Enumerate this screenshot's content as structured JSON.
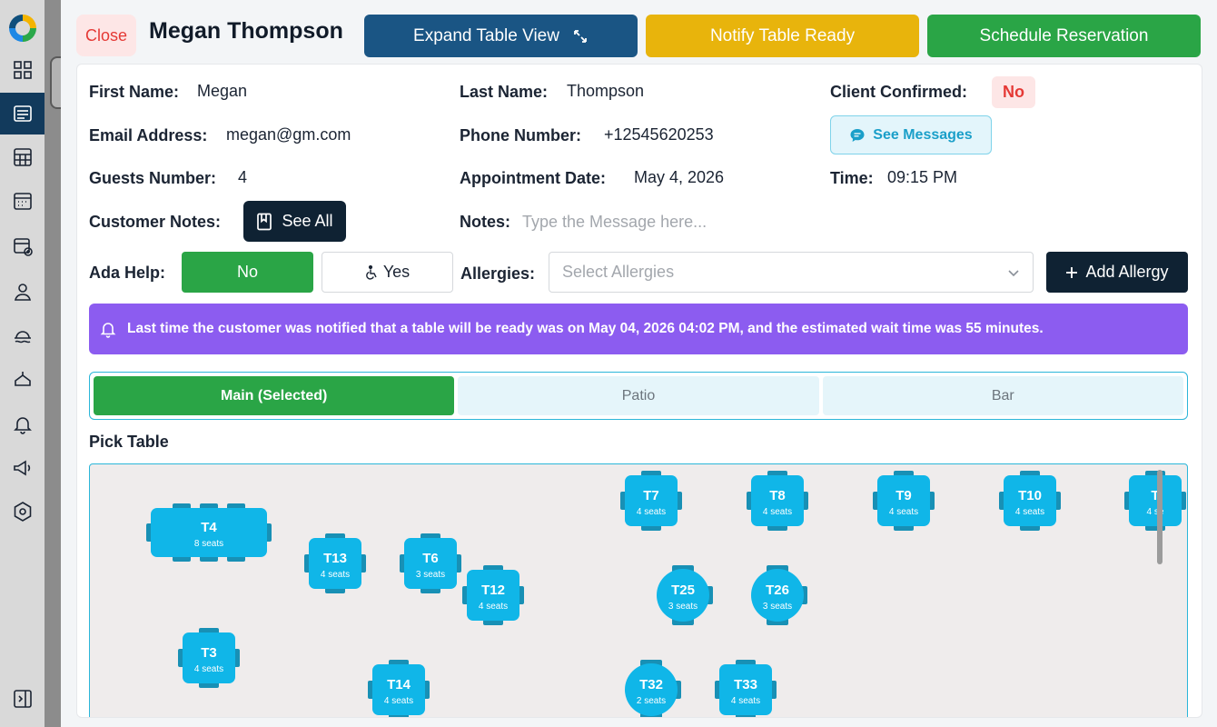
{
  "modal": {
    "close_label": "Close",
    "title": "Megan Thompson",
    "expand_label": "Expand Table View",
    "notify_label": "Notify Table Ready",
    "schedule_label": "Schedule Reservation"
  },
  "customer": {
    "first_name_label": "First Name:",
    "first_name": "Megan",
    "last_name_label": "Last Name:",
    "last_name": "Thompson",
    "confirmed_label": "Client Confirmed:",
    "confirmed": "No",
    "email_label": "Email Address:",
    "email": "megan@gm.com",
    "phone_label": "Phone Number:",
    "phone": "+12545620253",
    "see_messages_label": "See Messages",
    "guests_label": "Guests Number:",
    "guests": "4",
    "date_label": "Appointment Date:",
    "date": "May 4, 2026",
    "time_label": "Time:",
    "time": "09:15 PM",
    "customer_notes_label": "Customer Notes:",
    "see_all_label": "See All",
    "notes_label": "Notes:",
    "notes_placeholder": "Type the Message here...",
    "ada_label": "Ada Help:",
    "ada_no": "No",
    "ada_yes": "Yes",
    "allergies_label": "Allergies:",
    "allergies_placeholder": "Select Allergies",
    "add_allergy_label": "Add Allergy"
  },
  "alert": {
    "text": "Last time the customer was notified that a table will be ready was on May 04, 2026 04:02 PM, and the estimated wait time was 55 minutes."
  },
  "sections": {
    "tabs": [
      "Main (Selected)",
      "Patio",
      "Bar"
    ],
    "selected": 0
  },
  "pick_table": {
    "title": "Pick Table",
    "tables": [
      {
        "name": "T4",
        "seats": "8 seats",
        "shape": "rect-wide"
      },
      {
        "name": "T13",
        "seats": "4 seats",
        "shape": "square"
      },
      {
        "name": "T6",
        "seats": "3 seats",
        "shape": "square"
      },
      {
        "name": "T12",
        "seats": "4 seats",
        "shape": "square"
      },
      {
        "name": "T7",
        "seats": "4 seats",
        "shape": "square"
      },
      {
        "name": "T8",
        "seats": "4 seats",
        "shape": "square"
      },
      {
        "name": "T9",
        "seats": "4 seats",
        "shape": "square"
      },
      {
        "name": "T10",
        "seats": "4 seats",
        "shape": "square"
      },
      {
        "name": "T",
        "seats": "4 se",
        "shape": "square"
      },
      {
        "name": "T25",
        "seats": "3 seats",
        "shape": "round"
      },
      {
        "name": "T26",
        "seats": "3 seats",
        "shape": "round"
      },
      {
        "name": "T3",
        "seats": "4 seats",
        "shape": "square"
      },
      {
        "name": "T14",
        "seats": "4 seats",
        "shape": "square"
      },
      {
        "name": "T32",
        "seats": "2 seats",
        "shape": "round"
      },
      {
        "name": "T33",
        "seats": "4 seats",
        "shape": "square"
      }
    ]
  },
  "colors": {
    "table_fill": "#10b6e8",
    "chair_fill": "#1890b5",
    "accent_green": "#2aa546",
    "notify_yellow": "#e8b40c",
    "expand_blue": "#1a5584",
    "alert_purple": "#8c5cf0"
  },
  "icons": {
    "expand": "expand-arrows-icon",
    "messages": "chat-bubble-icon",
    "notes": "notebook-icon",
    "wheelchair": "wheelchair-icon",
    "chevron": "chevron-down-icon",
    "plus": "plus-icon",
    "bell": "bell-icon"
  }
}
